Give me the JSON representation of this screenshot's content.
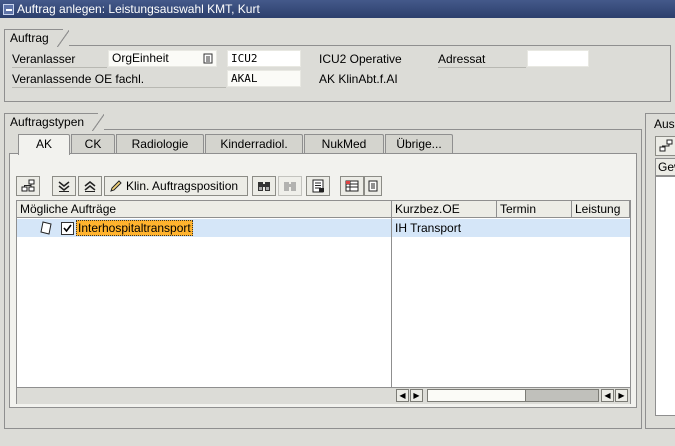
{
  "window": {
    "title": "Auftrag anlegen: Leistungsauswahl KMT, Kurt"
  },
  "auftrag": {
    "group_title": "Auftrag",
    "veranlasser_label": "Veranlasser",
    "orgeinheit_value": "OrgEinheit",
    "icu2_value": "ICU2",
    "icu2_text": "ICU2 Operative",
    "adressat_label": "Adressat",
    "adressat_value": "",
    "oe_label": "Veranlassende OE fachl.",
    "oe_value": "AKAL",
    "oe_text": "AK KlinAbt.f.AI"
  },
  "auftragstypen": {
    "group_title": "Auftragstypen",
    "tabs": [
      {
        "label": "AK"
      },
      {
        "label": "CK"
      },
      {
        "label": "Radiologie"
      },
      {
        "label": "Kinderradiol."
      },
      {
        "label": "NukMed"
      },
      {
        "label": "Übrige..."
      }
    ],
    "toolbar": {
      "klin_label": "Klin. Auftragsposition"
    },
    "grid": {
      "columns": [
        {
          "label": "Mögliche Aufträge"
        },
        {
          "label": "Kurzbez.OE"
        },
        {
          "label": "Termin"
        },
        {
          "label": "Leistung"
        }
      ],
      "rows": [
        {
          "auftrag": "Interhospitaltransport",
          "kurzbez": "IH Transport",
          "termin": "",
          "leistung": ""
        }
      ]
    }
  },
  "right_panel": {
    "title": "Aus",
    "button_label": "Gew"
  },
  "colors": {
    "titlebar": "#2c3f6c",
    "selection": "#d5e6f8",
    "highlight": "#ffb32e"
  }
}
